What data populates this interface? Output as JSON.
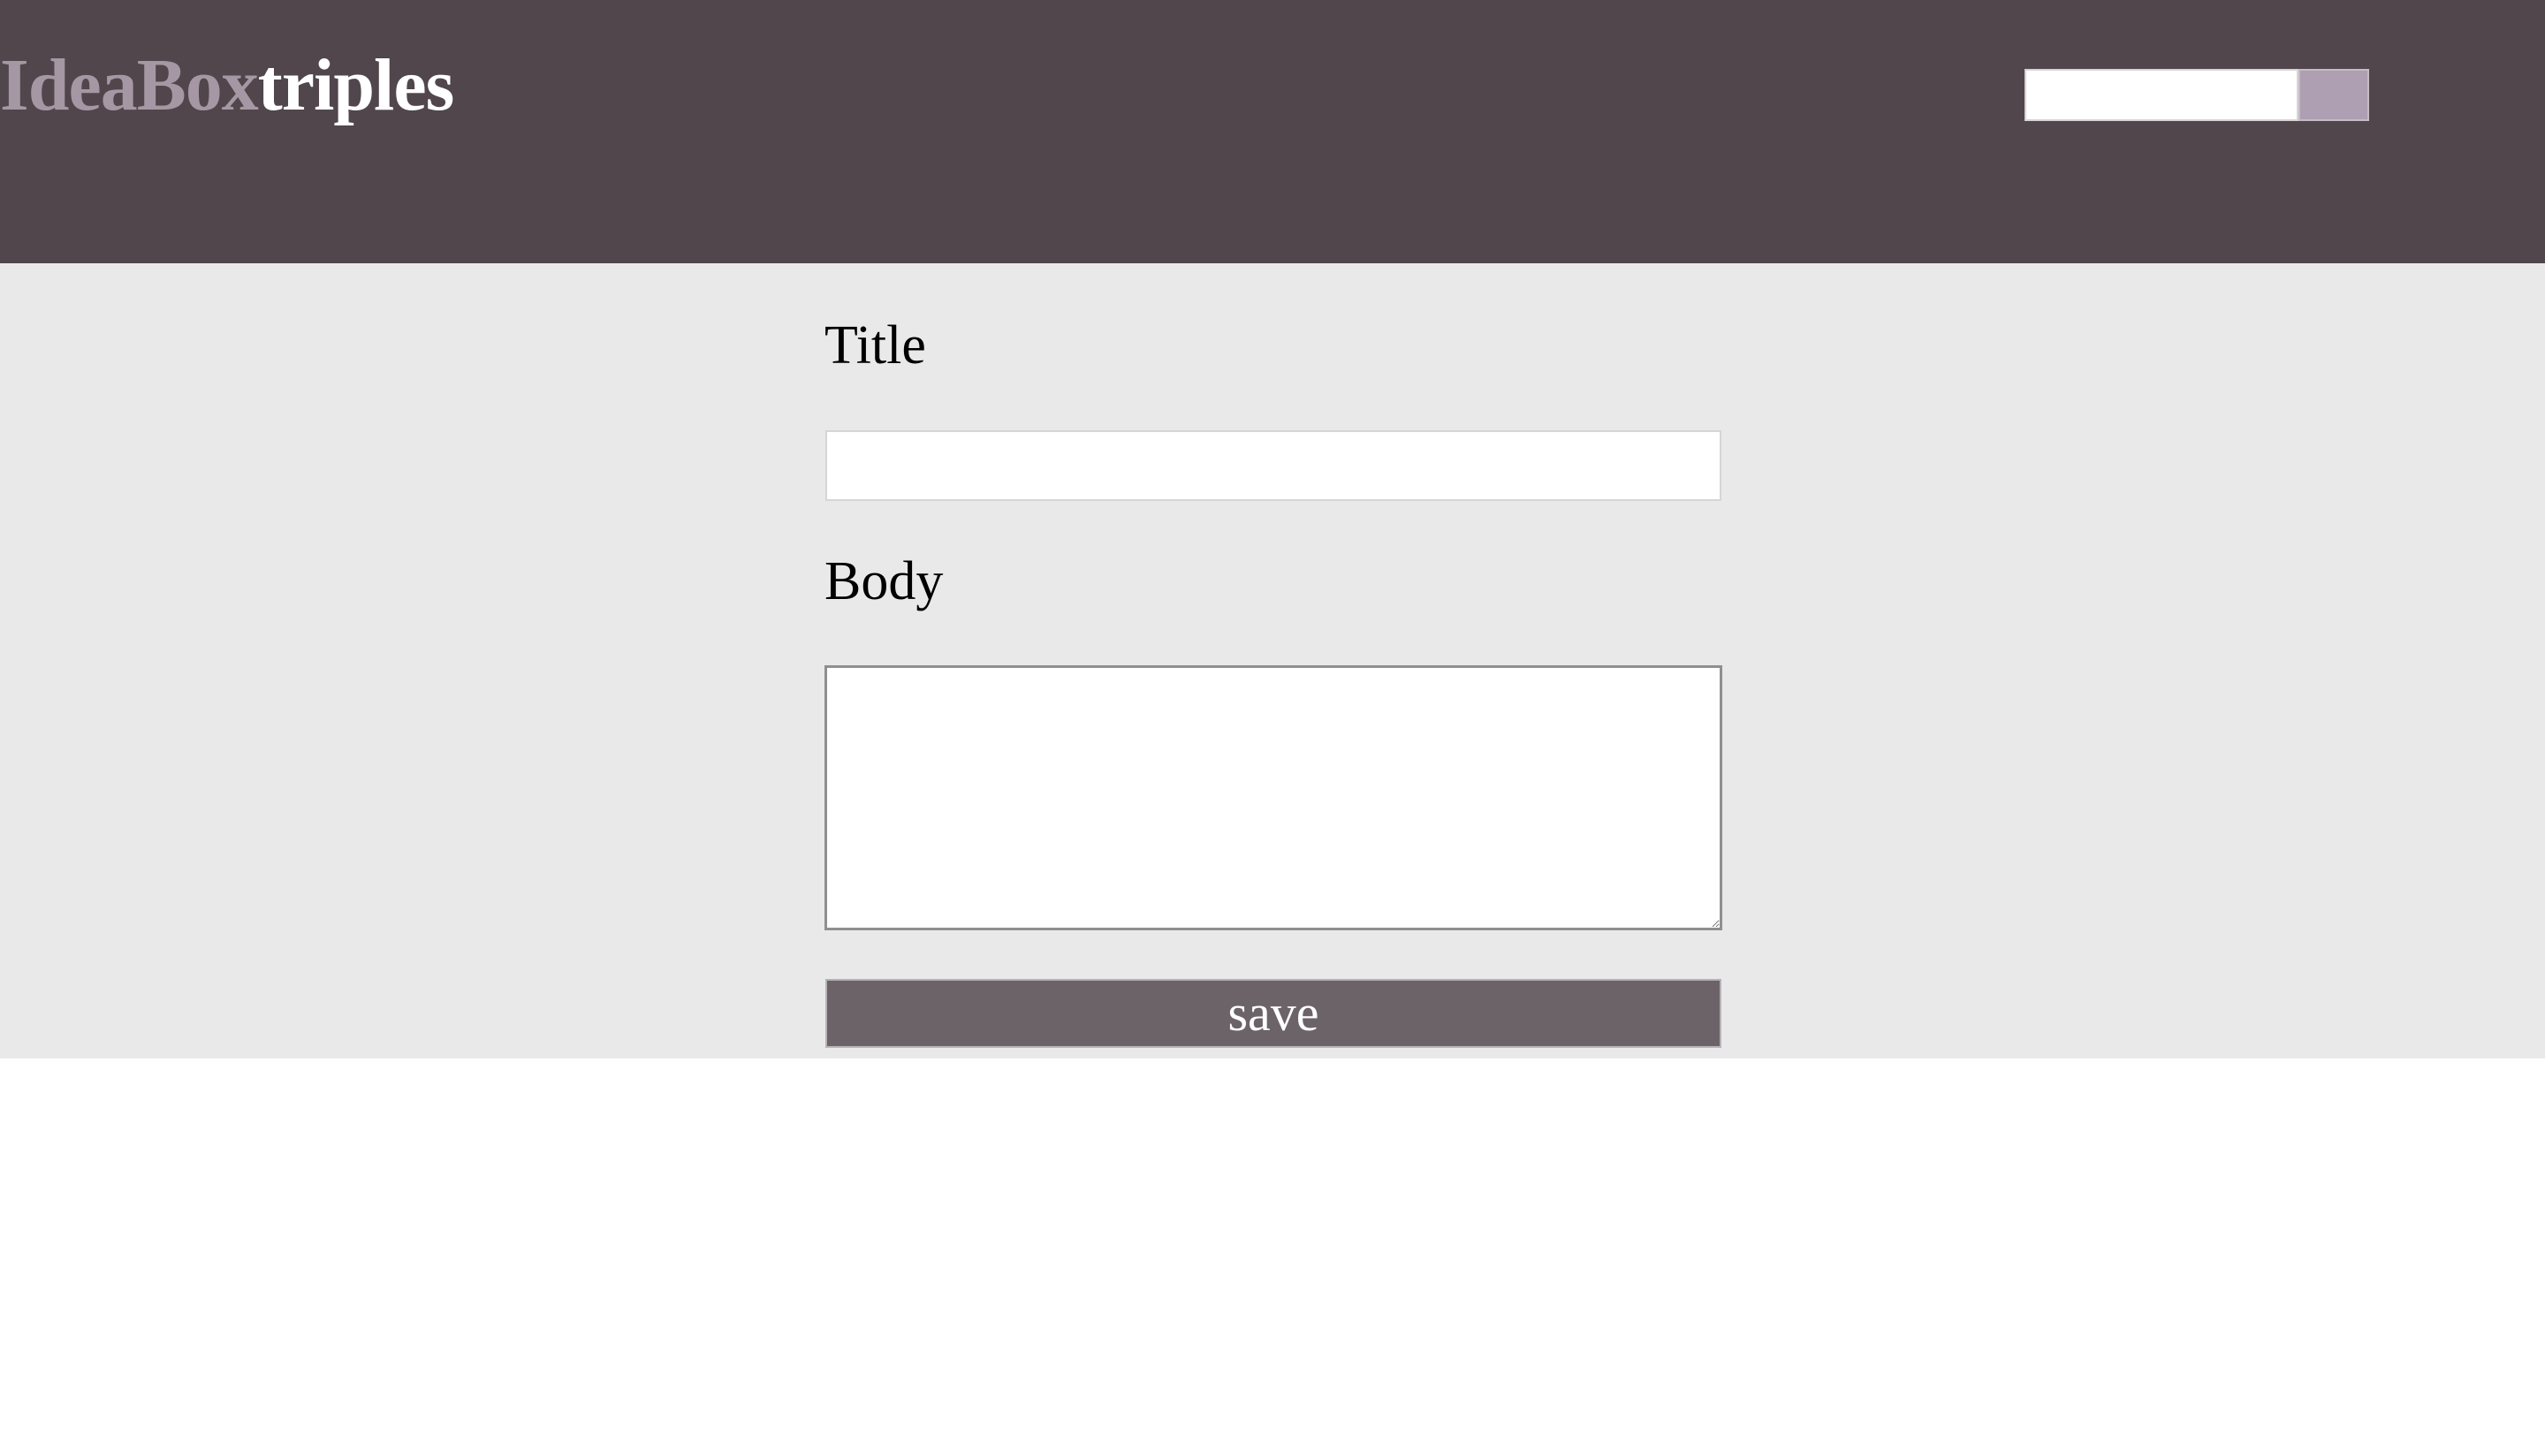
{
  "header": {
    "brand_primary": "IdeaBox",
    "brand_secondary": "triples",
    "search": {
      "value": "",
      "placeholder": "",
      "button_label": ""
    }
  },
  "form": {
    "title_label": "Title",
    "title_value": "",
    "body_label": "Body",
    "body_value": "",
    "save_label": "save"
  },
  "colors": {
    "header_bg": "#50464b",
    "brand_primary": "#a697a4",
    "brand_secondary": "#ffffff",
    "search_button": "#ae9fb2",
    "main_bg": "#e9e9e9",
    "save_button": "#6c6369"
  }
}
